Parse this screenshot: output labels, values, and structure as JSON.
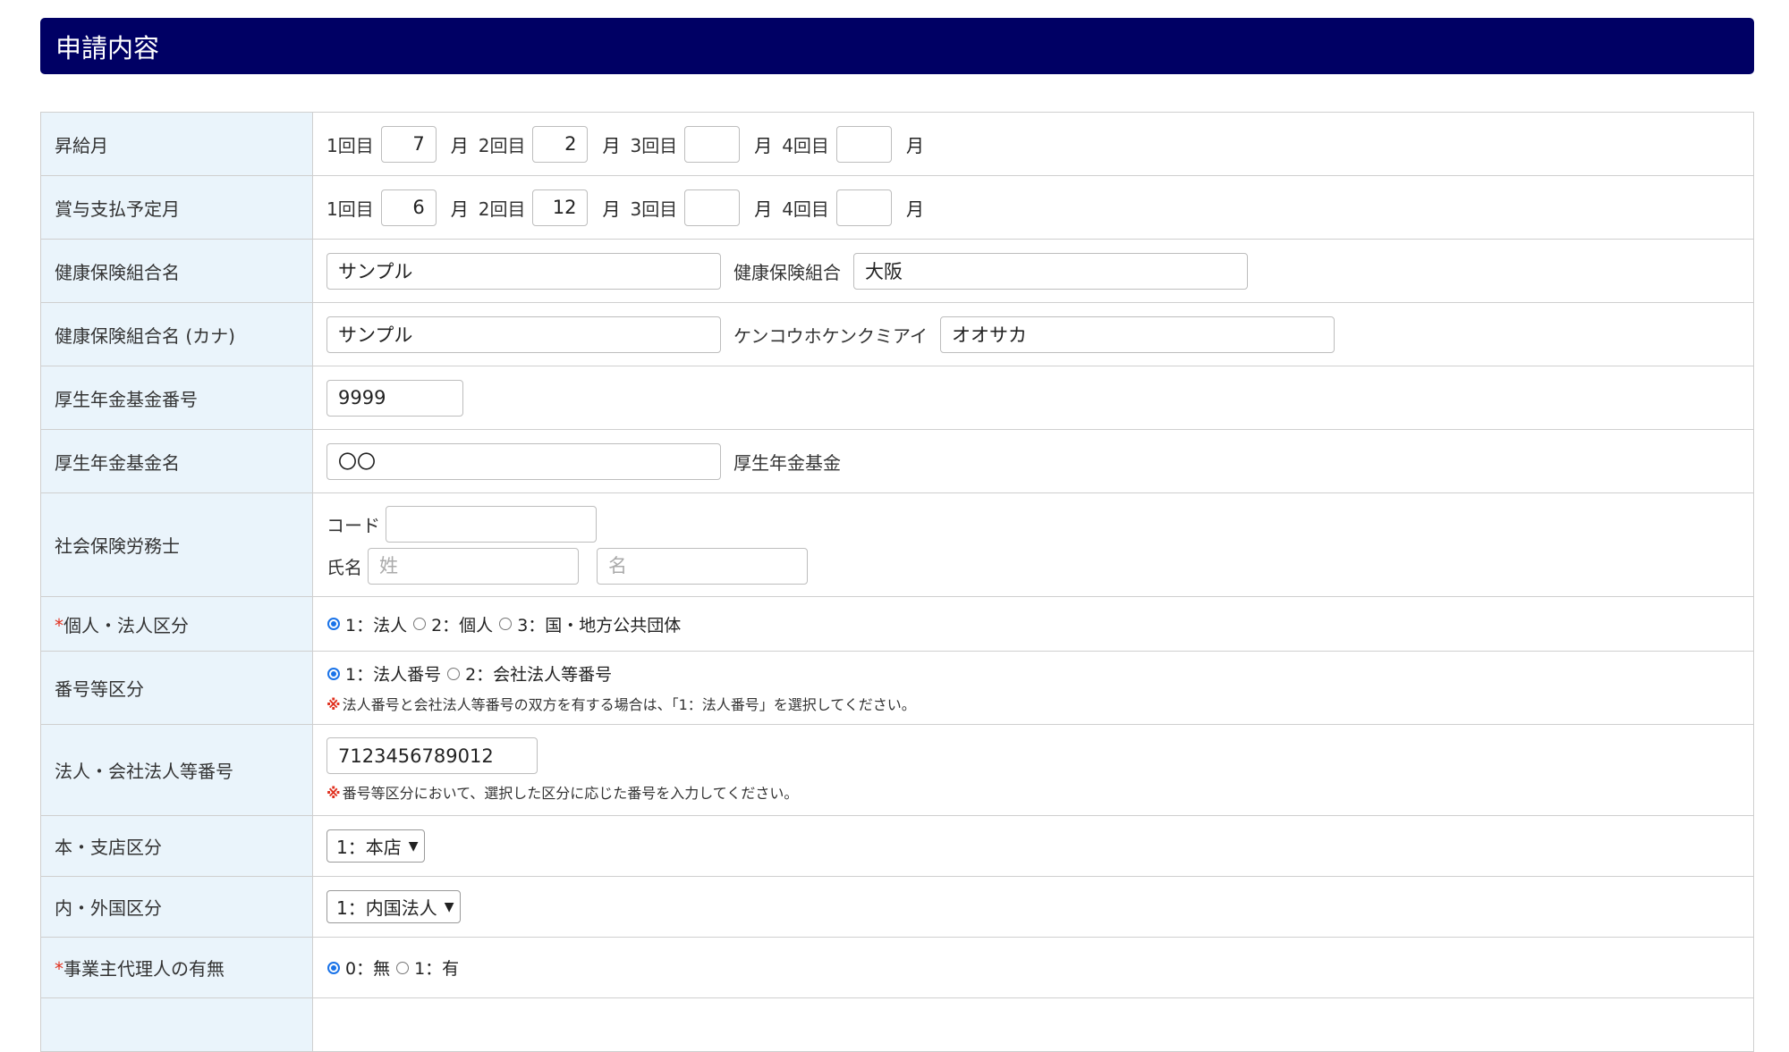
{
  "header": {
    "title": "申請内容"
  },
  "rows": {
    "shokyu": {
      "label": "昇給月",
      "items": [
        {
          "label": "1回目",
          "value": "7"
        },
        {
          "label": "2回目",
          "value": "2"
        },
        {
          "label": "3回目",
          "value": ""
        },
        {
          "label": "4回目",
          "value": ""
        }
      ],
      "unit": "月"
    },
    "shoyo": {
      "label": "賞与支払予定月",
      "items": [
        {
          "label": "1回目",
          "value": "6"
        },
        {
          "label": "2回目",
          "value": "12"
        },
        {
          "label": "3回目",
          "value": ""
        },
        {
          "label": "4回目",
          "value": ""
        }
      ],
      "unit": "月"
    },
    "kenpo": {
      "label": "健康保険組合名",
      "input1": "サンプル",
      "middle": "健康保険組合",
      "input2": "大阪"
    },
    "kenpo_kana": {
      "label": "健康保険組合名 (カナ)",
      "input1": "サンプル",
      "middle": "ケンコウホケンクミアイ",
      "input2": "オオサカ"
    },
    "kosei_no": {
      "label": "厚生年金基金番号",
      "value": "9999"
    },
    "kosei_name": {
      "label": "厚生年金基金名",
      "value": "〇〇",
      "suffix": "厚生年金基金"
    },
    "sharoushi": {
      "label": "社会保険労務士",
      "code_label": "コード",
      "code_value": "",
      "name_label": "氏名",
      "sei_placeholder": "姓",
      "mei_placeholder": "名"
    },
    "kojin_hojin": {
      "required": "*",
      "label": "個人・法人区分",
      "options": [
        "1：法人",
        "2：個人",
        "3：国・地方公共団体"
      ],
      "selected": 0
    },
    "bango_kubun": {
      "label": "番号等区分",
      "options": [
        "1：法人番号",
        "2：会社法人等番号"
      ],
      "selected": 0,
      "note_mark": "※",
      "note": "法人番号と会社法人等番号の双方を有する場合は、「1：法人番号」を選択してください。"
    },
    "hojin_bango": {
      "label": "法人・会社法人等番号",
      "value": "7123456789012",
      "note_mark": "※",
      "note": "番号等区分において、選択した区分に応じた番号を入力してください。"
    },
    "honshiten": {
      "label": "本・支店区分",
      "selected": "1：本店"
    },
    "naigai": {
      "label": "内・外国区分",
      "selected": "1：内国法人"
    },
    "dairinin": {
      "required": "*",
      "label": "事業主代理人の有無",
      "options": [
        "0：無",
        "1：有"
      ],
      "selected": 0
    }
  },
  "colors": {
    "header_bg": "#000064",
    "label_bg": "#eaf4fb",
    "required": "#e0301e",
    "radio": "#1a73e8"
  }
}
